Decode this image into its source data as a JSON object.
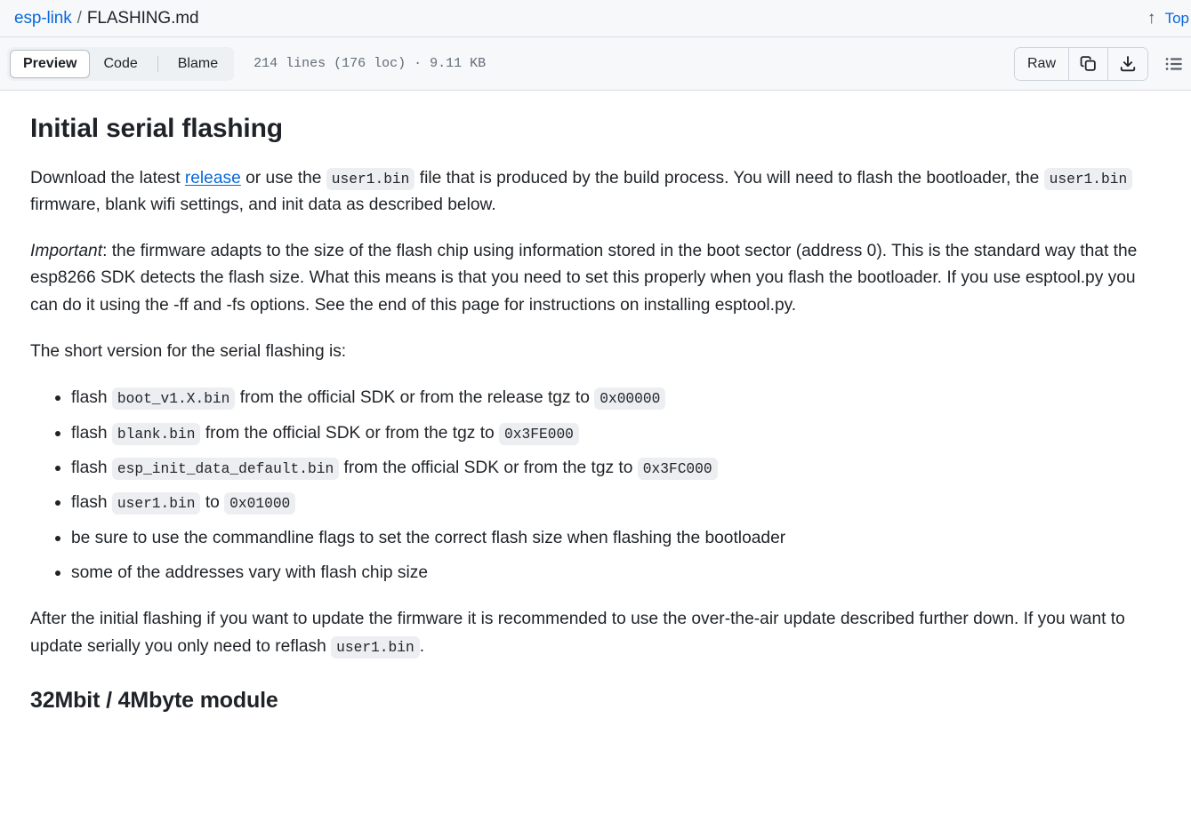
{
  "header": {
    "repo": "esp-link",
    "separator": "/",
    "filename": "FLASHING.md",
    "top_link": "Top",
    "arrow_up_glyph": "↑"
  },
  "toolbar": {
    "tabs": [
      {
        "label": "Preview",
        "selected": true
      },
      {
        "label": "Code",
        "selected": false
      },
      {
        "label": "Blame",
        "selected": false
      }
    ],
    "file_meta": "214 lines (176 loc) · 9.11 KB",
    "raw_label": "Raw",
    "copy_icon": "copy-icon",
    "download_icon": "download-icon",
    "outline_icon": "outline-list-icon"
  },
  "content": {
    "h1": "Initial serial flashing",
    "p1": {
      "a": "Download the latest ",
      "link": "release",
      "b": " or use the ",
      "code1": "user1.bin",
      "c": " file that is produced by the build process. You will need to flash the bootloader, the ",
      "code2": "user1.bin",
      "d": " firmware, blank wifi settings, and init data as described below."
    },
    "p2": {
      "em": "Important",
      "rest": ": the firmware adapts to the size of the flash chip using information stored in the boot sector (address 0). This is the standard way that the esp8266 SDK detects the flash size. What this means is that you need to set this properly when you flash the bootloader. If you use esptool.py you can do it using the -ff and -fs options. See the end of this page for instructions on installing esptool.py."
    },
    "p3": "The short version for the serial flashing is:",
    "list": [
      {
        "a": "flash ",
        "code1": "boot_v1.X.bin",
        "b": " from the official SDK or from the release tgz to ",
        "code2": "0x00000",
        "c": ""
      },
      {
        "a": "flash ",
        "code1": "blank.bin",
        "b": " from the official SDK or from the tgz to ",
        "code2": "0x3FE000",
        "c": ""
      },
      {
        "a": "flash ",
        "code1": "esp_init_data_default.bin",
        "b": " from the official SDK or from the tgz to ",
        "code2": "0x3FC000",
        "c": ""
      },
      {
        "a": "flash ",
        "code1": "user1.bin",
        "b": " to ",
        "code2": "0x01000",
        "c": ""
      },
      {
        "a": "be sure to use the commandline flags to set the correct flash size when flashing the bootloader",
        "code1": "",
        "b": "",
        "code2": "",
        "c": ""
      },
      {
        "a": "some of the addresses vary with flash chip size",
        "code1": "",
        "b": "",
        "code2": "",
        "c": ""
      }
    ],
    "p4": {
      "a": "After the initial flashing if you want to update the firmware it is recommended to use the over-the-air update described further down. If you want to update serially you only need to reflash ",
      "code1": "user1.bin",
      "b": "."
    },
    "h2": "32Mbit / 4Mbyte module"
  },
  "colors": {
    "link": "#0969da",
    "text": "#1f2328",
    "muted": "#636c76",
    "header_bg": "#f6f8fa",
    "border": "#d8dee4",
    "code_bg": "#eceef1"
  }
}
